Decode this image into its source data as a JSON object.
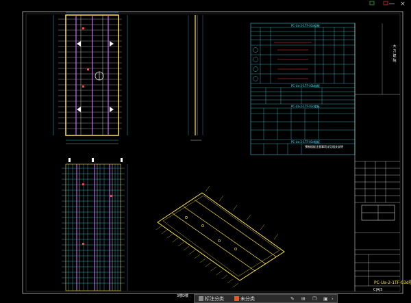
{
  "window": {
    "controls": [
      "—",
      "×"
    ]
  },
  "drawing": {
    "titleblock_label": "PC-Ua-2-1TF-03d楼",
    "titleblock_side_text": "大 力\n建 院",
    "caption_3d": "3楼D楼",
    "status_right": "C|A|S"
  },
  "table": {
    "title_1": "PC-Ua-2-1TF-03a楼板",
    "title_2": "PC-Ua-2-1TF-03b楼板",
    "title_3": "PC-Ua-2-1TF-03c楼板",
    "title_4": "PC-Ua-2-1TF-03d楼板",
    "note": "预制楼板注意事项详见相关说明"
  },
  "toolbar": {
    "items": [
      {
        "label": "标注分类",
        "color": "#888888"
      },
      {
        "label": "未分类",
        "color": "#e8572a"
      }
    ],
    "icons": [
      "ruler-icon",
      "layers-icon",
      "copy-icon",
      "paste-icon",
      "chevron-right-icon"
    ]
  },
  "colors": {
    "background": "#000000",
    "yellow": "#ffe54a",
    "cyan": "#4de8ff",
    "red": "#ff4040",
    "magenta": "#c86cff",
    "white": "#ffffff"
  }
}
